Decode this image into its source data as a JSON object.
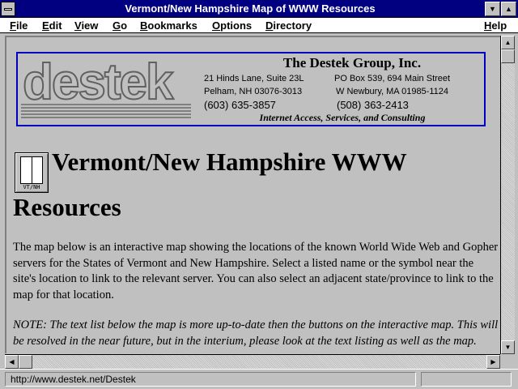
{
  "window": {
    "title": "Vermont/New Hampshire Map of WWW Resources",
    "minimize_glyph": "▼",
    "maximize_glyph": "▲"
  },
  "menu": {
    "items": [
      "File",
      "Edit",
      "View",
      "Go",
      "Bookmarks",
      "Options",
      "Directory"
    ],
    "help": "Help"
  },
  "banner": {
    "logo_text": "destek",
    "company": "The Destek Group, Inc.",
    "address_left_1": "21 Hinds Lane, Suite 23L",
    "address_left_2": "Pelham, NH  03076-3013",
    "address_right_1": "PO Box 539, 694 Main Street",
    "address_right_2": "W Newbury, MA  01985-1124",
    "phone_left": "(603) 635-3857",
    "phone_right": "(508) 363-2413",
    "tagline": "Internet Access, Services, and Consulting"
  },
  "page": {
    "icon_label": "VT/NH",
    "heading_line1": "Vermont/New Hampshire WWW",
    "heading_line2": "Resources",
    "paragraph1": "The map below is an interactive map showing the locations of the known World Wide Web and Gopher servers for the States of Vermont and New Hampshire. Select a listed name or the symbol near the site's location to link to the relevant server. You can also select an adjacent state/province to link to the map for that location.",
    "paragraph2": "NOTE: The text list below the map is more up-to-date then the buttons on the interactive map. This will be resolved in the near future, but in the interium, please look at the text listing as well as the map."
  },
  "status": {
    "url": "http://www.destek.net/Destek"
  },
  "scrollbar": {
    "up": "▲",
    "down": "▼",
    "left": "◀",
    "right": "▶"
  },
  "colors": {
    "title_bar": "#000080",
    "banner_border": "#0000c0",
    "chrome": "#c0c0c0"
  }
}
